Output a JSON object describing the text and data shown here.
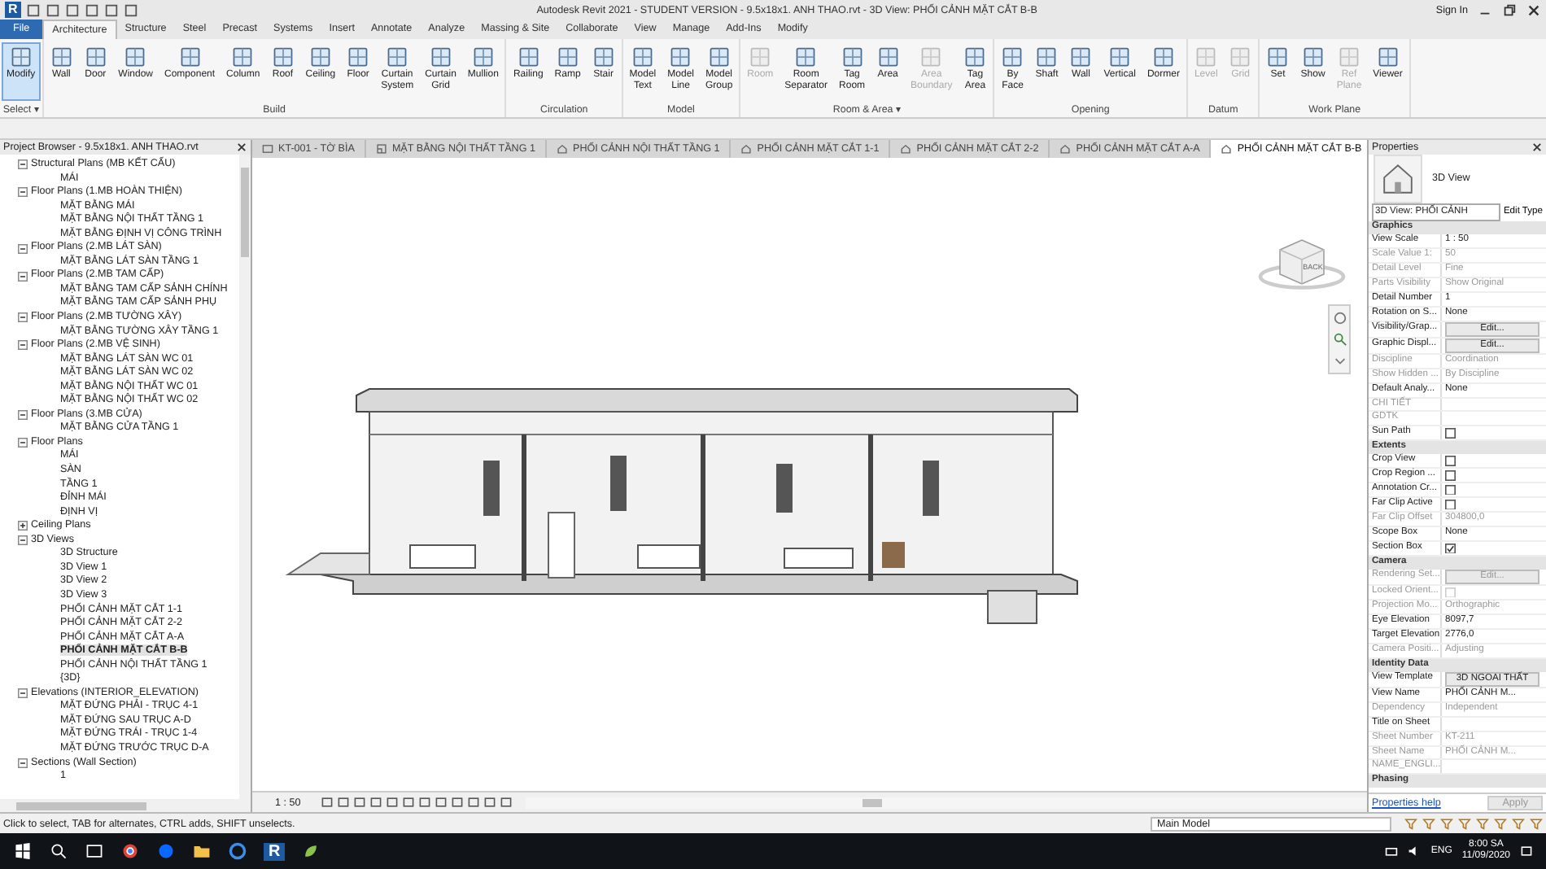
{
  "title_bar": {
    "logo": "R",
    "title": "Autodesk Revit 2021 - STUDENT VERSION - 9.5x18x1. ANH THAO.rvt - 3D View: PHỐI CẢNH MẶT CẮT B-B",
    "sign_in": "Sign In"
  },
  "ribbon_tabs": [
    {
      "label": "File",
      "kind": "app",
      "selected": false
    },
    {
      "label": "Architecture",
      "kind": "tab",
      "selected": true
    },
    {
      "label": "Structure",
      "kind": "tab",
      "selected": false
    },
    {
      "label": "Steel",
      "kind": "tab",
      "selected": false
    },
    {
      "label": "Precast",
      "kind": "tab",
      "selected": false
    },
    {
      "label": "Systems",
      "kind": "tab",
      "selected": false
    },
    {
      "label": "Insert",
      "kind": "tab",
      "selected": false
    },
    {
      "label": "Annotate",
      "kind": "tab",
      "selected": false
    },
    {
      "label": "Analyze",
      "kind": "tab",
      "selected": false
    },
    {
      "label": "Massing & Site",
      "kind": "tab",
      "selected": false
    },
    {
      "label": "Collaborate",
      "kind": "tab",
      "selected": false
    },
    {
      "label": "View",
      "kind": "tab",
      "selected": false
    },
    {
      "label": "Manage",
      "kind": "tab",
      "selected": false
    },
    {
      "label": "Add-Ins",
      "kind": "tab",
      "selected": false
    },
    {
      "label": "Modify",
      "kind": "tab",
      "selected": false
    }
  ],
  "ribbon_panels": [
    {
      "title": "Select ▾",
      "tools": [
        {
          "label": "Modify",
          "selected": true,
          "disabled": false
        }
      ]
    },
    {
      "title": "Build",
      "tools": [
        {
          "label": "Wall",
          "selected": false,
          "disabled": false
        },
        {
          "label": "Door",
          "selected": false,
          "disabled": false
        },
        {
          "label": "Window",
          "selected": false,
          "disabled": false
        },
        {
          "label": "Component",
          "selected": false,
          "disabled": false
        },
        {
          "label": "Column",
          "selected": false,
          "disabled": false
        },
        {
          "label": "Roof",
          "selected": false,
          "disabled": false
        },
        {
          "label": "Ceiling",
          "selected": false,
          "disabled": false
        },
        {
          "label": "Floor",
          "selected": false,
          "disabled": false
        },
        {
          "label": "Curtain System",
          "selected": false,
          "disabled": false
        },
        {
          "label": "Curtain Grid",
          "selected": false,
          "disabled": false
        },
        {
          "label": "Mullion",
          "selected": false,
          "disabled": false
        }
      ]
    },
    {
      "title": "Circulation",
      "tools": [
        {
          "label": "Railing",
          "selected": false,
          "disabled": false
        },
        {
          "label": "Ramp",
          "selected": false,
          "disabled": false
        },
        {
          "label": "Stair",
          "selected": false,
          "disabled": false
        }
      ]
    },
    {
      "title": "Model",
      "tools": [
        {
          "label": "Model Text",
          "selected": false,
          "disabled": false
        },
        {
          "label": "Model Line",
          "selected": false,
          "disabled": false
        },
        {
          "label": "Model Group",
          "selected": false,
          "disabled": false
        }
      ]
    },
    {
      "title": "Room & Area ▾",
      "tools": [
        {
          "label": "Room",
          "selected": false,
          "disabled": true
        },
        {
          "label": "Room Separator",
          "selected": false,
          "disabled": false
        },
        {
          "label": "Tag Room",
          "selected": false,
          "disabled": false
        },
        {
          "label": "Area",
          "selected": false,
          "disabled": false
        },
        {
          "label": "Area Boundary",
          "selected": false,
          "disabled": true
        },
        {
          "label": "Tag Area",
          "selected": false,
          "disabled": false
        }
      ]
    },
    {
      "title": "Opening",
      "tools": [
        {
          "label": "By Face",
          "selected": false,
          "disabled": false
        },
        {
          "label": "Shaft",
          "selected": false,
          "disabled": false
        },
        {
          "label": "Wall",
          "selected": false,
          "disabled": false
        },
        {
          "label": "Vertical",
          "selected": false,
          "disabled": false
        },
        {
          "label": "Dormer",
          "selected": false,
          "disabled": false
        }
      ]
    },
    {
      "title": "Datum",
      "tools": [
        {
          "label": "Level",
          "selected": false,
          "disabled": true
        },
        {
          "label": "Grid",
          "selected": false,
          "disabled": true
        }
      ]
    },
    {
      "title": "Work Plane",
      "tools": [
        {
          "label": "Set",
          "selected": false,
          "disabled": false
        },
        {
          "label": "Show",
          "selected": false,
          "disabled": false
        },
        {
          "label": "Ref Plane",
          "selected": false,
          "disabled": true
        },
        {
          "label": "Viewer",
          "selected": false,
          "disabled": false
        }
      ]
    }
  ],
  "project_browser": {
    "title": "Project Browser - 9.5x18x1. ANH THAO.rvt",
    "tree": [
      {
        "label": "Structural Plans (MB KẾT CẤU)",
        "expanded": true,
        "children": [
          {
            "label": "MÁI",
            "selected": false
          }
        ]
      },
      {
        "label": "Floor Plans (1.MB HOÀN THIỆN)",
        "expanded": true,
        "children": [
          {
            "label": "MẶT BẰNG MÁI",
            "selected": false
          },
          {
            "label": "MẶT BẰNG NỘI THẤT TẦNG 1",
            "selected": false
          },
          {
            "label": "MẶT BẰNG ĐỊNH VỊ CÔNG TRÌNH",
            "selected": false
          }
        ]
      },
      {
        "label": "Floor Plans (2.MB LÁT SÀN)",
        "expanded": true,
        "children": [
          {
            "label": "MẶT BẰNG LÁT SÀN TẦNG 1",
            "selected": false
          }
        ]
      },
      {
        "label": "Floor Plans (2.MB TAM CẤP)",
        "expanded": true,
        "children": [
          {
            "label": "MẶT BẰNG TAM CẤP SẢNH CHÍNH",
            "selected": false
          },
          {
            "label": "MẶT BẰNG TAM CẤP SẢNH PHỤ",
            "selected": false
          }
        ]
      },
      {
        "label": "Floor Plans (2.MB TƯỜNG XÂY)",
        "expanded": true,
        "children": [
          {
            "label": "MẶT BẰNG TƯỜNG XÂY TẦNG 1",
            "selected": false
          }
        ]
      },
      {
        "label": "Floor Plans (2.MB VỆ SINH)",
        "expanded": true,
        "children": [
          {
            "label": "MẶT BẰNG LÁT SÀN WC 01",
            "selected": false
          },
          {
            "label": "MẶT BẰNG LÁT SÀN WC 02",
            "selected": false
          },
          {
            "label": "MẶT BẰNG NỘI THẤT WC 01",
            "selected": false
          },
          {
            "label": "MẶT BẰNG NỘI THẤT WC 02",
            "selected": false
          }
        ]
      },
      {
        "label": "Floor Plans (3.MB CỬA)",
        "expanded": true,
        "children": [
          {
            "label": "MẶT BẰNG CỬA TẦNG 1",
            "selected": false
          }
        ]
      },
      {
        "label": "Floor Plans",
        "expanded": true,
        "children": [
          {
            "label": "MÁI",
            "selected": false
          },
          {
            "label": "SÀN",
            "selected": false
          },
          {
            "label": "TẦNG 1",
            "selected": false
          },
          {
            "label": "ĐỈNH MÁI",
            "selected": false
          },
          {
            "label": "ĐỊNH VỊ",
            "selected": false
          }
        ]
      },
      {
        "label": "Ceiling Plans",
        "expanded": false
      },
      {
        "label": "3D Views",
        "expanded": true,
        "children": [
          {
            "label": "3D Structure",
            "selected": false
          },
          {
            "label": "3D View 1",
            "selected": false
          },
          {
            "label": "3D View 2",
            "selected": false
          },
          {
            "label": "3D View 3",
            "selected": false
          },
          {
            "label": "PHỐI CẢNH MẶT CẮT 1-1",
            "selected": false
          },
          {
            "label": "PHỐI CẢNH MẶT CẮT 2-2",
            "selected": false
          },
          {
            "label": "PHỐI CẢNH MẶT CẮT A-A",
            "selected": false
          },
          {
            "label": "PHỐI CẢNH MẶT CẮT B-B",
            "selected": true
          },
          {
            "label": "PHỐI CẢNH NỘI THẤT TẦNG 1",
            "selected": false
          },
          {
            "label": "{3D}",
            "selected": false
          }
        ]
      },
      {
        "label": "Elevations (INTERIOR_ELEVATION)",
        "expanded": true,
        "children": [
          {
            "label": "MẶT ĐỨNG PHẢI - TRỤC 4-1",
            "selected": false
          },
          {
            "label": "MẶT ĐỨNG SAU TRỤC A-D",
            "selected": false
          },
          {
            "label": "MẶT ĐỨNG TRÁI - TRỤC 1-4",
            "selected": false
          },
          {
            "label": "MẶT ĐỨNG TRƯỚC TRỤC D-A",
            "selected": false
          }
        ]
      },
      {
        "label": "Sections (Wall Section)",
        "expanded": true,
        "children": [
          {
            "label": "1",
            "selected": false
          }
        ]
      }
    ]
  },
  "view_tabs": [
    {
      "label": "KT-001 - TỜ BÌA",
      "kind": "sheet",
      "selected": false
    },
    {
      "label": "MẶT BẰNG NỘI THẤT TẦNG 1",
      "kind": "plan",
      "selected": false
    },
    {
      "label": "PHỐI CẢNH NỘI THẤT TẦNG 1",
      "kind": "perspective",
      "selected": false
    },
    {
      "label": "PHỐI CẢNH MẶT CẮT 1-1",
      "kind": "perspective",
      "selected": false
    },
    {
      "label": "PHỐI CẢNH MẶT CẮT 2-2",
      "kind": "perspective",
      "selected": false
    },
    {
      "label": "PHỐI CẢNH MẶT CẮT A-A",
      "kind": "perspective",
      "selected": false
    },
    {
      "label": "PHỐI CẢNH MẶT CẮT B-B",
      "kind": "perspective",
      "selected": true
    }
  ],
  "view_cube": {
    "face": "BACK"
  },
  "view_bar": {
    "scale": "1 : 50"
  },
  "properties": {
    "title": "Properties",
    "type_name": "3D View",
    "type_selector": "3D View: PHỐI CẢNH",
    "edit_type": "Edit Type",
    "groups": [
      {
        "title": "Graphics",
        "rows": [
          {
            "name": "View Scale",
            "value": "1 : 50",
            "kind": "text",
            "disabled": false
          },
          {
            "name": "Scale Value 1:",
            "value": "50",
            "kind": "text",
            "disabled": true
          },
          {
            "name": "Detail Level",
            "value": "Fine",
            "kind": "text",
            "disabled": true
          },
          {
            "name": "Parts Visibility",
            "value": "Show Original",
            "kind": "text",
            "disabled": true
          },
          {
            "name": "Detail Number",
            "value": "1",
            "kind": "text",
            "disabled": false
          },
          {
            "name": "Rotation on S...",
            "value": "None",
            "kind": "text",
            "disabled": false
          },
          {
            "name": "Visibility/Grap...",
            "value": "Edit...",
            "kind": "button",
            "disabled": false
          },
          {
            "name": "Graphic Displ...",
            "value": "Edit...",
            "kind": "button",
            "disabled": false
          },
          {
            "name": "Discipline",
            "value": "Coordination",
            "kind": "text",
            "disabled": true
          },
          {
            "name": "Show Hidden ...",
            "value": "By Discipline",
            "kind": "text",
            "disabled": true
          },
          {
            "name": "Default Analy...",
            "value": "None",
            "kind": "text",
            "disabled": false
          },
          {
            "name": "CHI TIẾT",
            "kind": "text",
            "disabled": true
          },
          {
            "name": "GDTK",
            "kind": "text",
            "disabled": true
          },
          {
            "name": "Sun Path",
            "kind": "check",
            "checked": false,
            "disabled": false
          }
        ]
      },
      {
        "title": "Extents",
        "rows": [
          {
            "name": "Crop View",
            "kind": "check",
            "checked": false,
            "disabled": false
          },
          {
            "name": "Crop Region ...",
            "kind": "check",
            "checked": false,
            "disabled": false
          },
          {
            "name": "Annotation Cr...",
            "kind": "check",
            "checked": false,
            "disabled": false
          },
          {
            "name": "Far Clip Active",
            "kind": "check",
            "checked": false,
            "disabled": false
          },
          {
            "name": "Far Clip Offset",
            "value": "304800,0",
            "kind": "text",
            "disabled": true
          },
          {
            "name": "Scope Box",
            "value": "None",
            "kind": "text",
            "disabled": false
          },
          {
            "name": "Section Box",
            "kind": "check",
            "checked": true,
            "disabled": false
          }
        ]
      },
      {
        "title": "Camera",
        "rows": [
          {
            "name": "Rendering Set...",
            "value": "Edit...",
            "kind": "button",
            "disabled": true
          },
          {
            "name": "Locked Orient...",
            "kind": "check",
            "checked": false,
            "disabled": true
          },
          {
            "name": "Projection Mo...",
            "value": "Orthographic",
            "kind": "text",
            "disabled": true
          },
          {
            "name": "Eye Elevation",
            "value": "8097,7",
            "kind": "text",
            "disabled": false
          },
          {
            "name": "Target Elevation",
            "value": "2776,0",
            "kind": "text",
            "disabled": false
          },
          {
            "name": "Camera Positi...",
            "value": "Adjusting",
            "kind": "text",
            "disabled": true
          }
        ]
      },
      {
        "title": "Identity Data",
        "rows": [
          {
            "name": "View Template",
            "value": "3D NGOAI THẤT",
            "kind": "button",
            "disabled": false
          },
          {
            "name": "View Name",
            "value": "PHỐI CẢNH M...",
            "kind": "text",
            "disabled": false
          },
          {
            "name": "Dependency",
            "value": "Independent",
            "kind": "text",
            "disabled": true
          },
          {
            "name": "Title on Sheet",
            "kind": "text",
            "disabled": false
          },
          {
            "name": "Sheet Number",
            "value": "KT-211",
            "kind": "text",
            "disabled": true
          },
          {
            "name": "Sheet Name",
            "value": "PHỐI CẢNH M...",
            "kind": "text",
            "disabled": true
          },
          {
            "name": "NAME_ENGLI...",
            "kind": "text",
            "disabled": true
          }
        ]
      },
      {
        "title": "Phasing"
      }
    ],
    "help": "Properties help",
    "apply": "Apply"
  },
  "status_bar": {
    "text": "Click to select, TAB for alternates, CTRL adds, SHIFT unselects.",
    "model": "Main Model"
  },
  "taskbar": {
    "revit": "R",
    "lang": "ENG",
    "time": "8:00 SA",
    "date": "11/09/2020"
  }
}
